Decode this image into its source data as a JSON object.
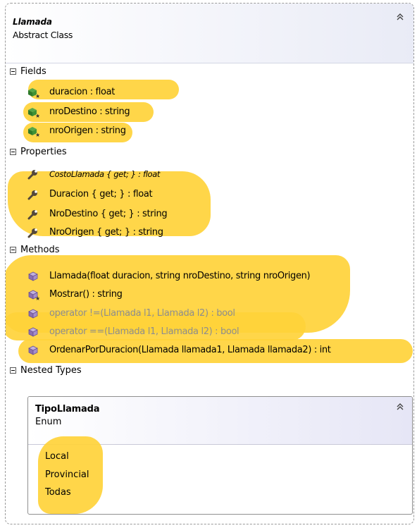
{
  "class": {
    "name": "Llamada",
    "kind": "Abstract Class"
  },
  "compartments": {
    "fields": "Fields",
    "properties": "Properties",
    "methods": "Methods",
    "nested_types": "Nested Types"
  },
  "fields": [
    {
      "text": "duracion : float",
      "icon": "protected-field-icon"
    },
    {
      "text": "nroDestino : string",
      "icon": "protected-field-icon"
    },
    {
      "text": "nroOrigen : string",
      "icon": "protected-field-icon"
    }
  ],
  "properties": [
    {
      "text": "CostoLlamada { get; } : float",
      "icon": "property-wrench-icon",
      "abstract": true
    },
    {
      "text": "Duracion { get; } : float",
      "icon": "property-wrench-icon"
    },
    {
      "text": "NroDestino { get; } : string",
      "icon": "property-wrench-icon"
    },
    {
      "text": "NroOrigen { get; } : string",
      "icon": "property-wrench-icon"
    }
  ],
  "methods": [
    {
      "text": "Llamada(float duracion, string nroDestino, string nroOrigen)",
      "icon": "method-icon"
    },
    {
      "text": "Mostrar() : string",
      "icon": "protected-method-icon"
    },
    {
      "text": "operator !=(Llamada l1, Llamada l2) : bool",
      "icon": "method-icon",
      "dim": true
    },
    {
      "text": "operator ==(Llamada l1, Llamada l2) : bool",
      "icon": "method-icon",
      "dim": true
    },
    {
      "text": "OrdenarPorDuracion(Llamada llamada1, Llamada llamada2) : int",
      "icon": "method-icon"
    }
  ],
  "nested_type": {
    "name": "TipoLlamada",
    "kind": "Enum",
    "values": [
      "Local",
      "Provincial",
      "Todas"
    ]
  },
  "colors": {
    "highlight": "#ffd23a",
    "header_gradient_end": "#e9ebf6",
    "dim_text": "#8d8d8d",
    "field_icon": "#2f7a2a",
    "method_icon": "#8a6fb0",
    "wrench_icon": "#55483a"
  }
}
